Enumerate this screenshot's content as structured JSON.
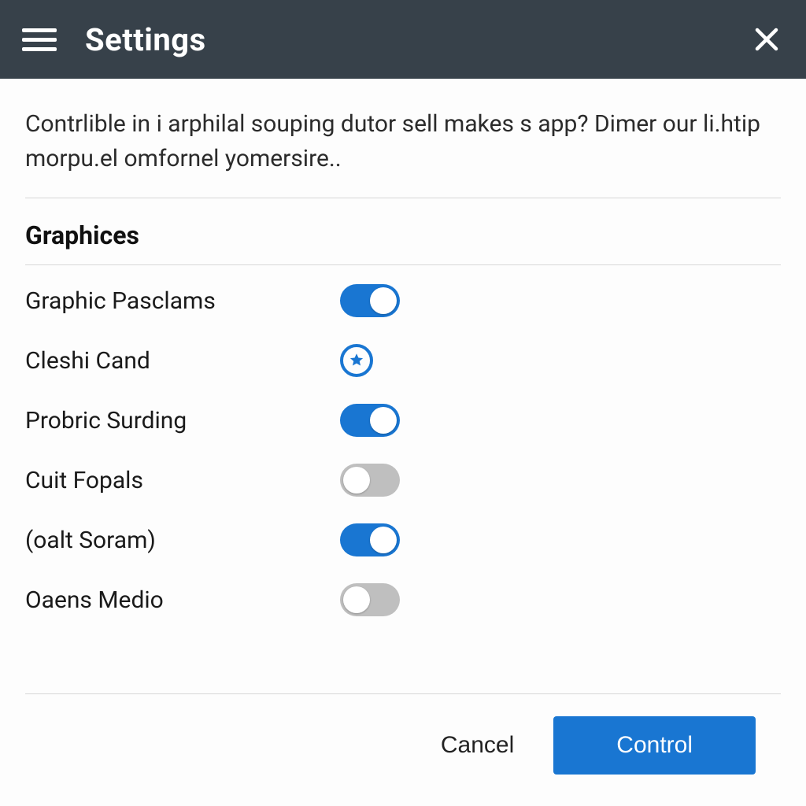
{
  "header": {
    "title": "Settings"
  },
  "description": "Contrlible in i arphilal souping dutor sell makes s app? Dimer our li.htip morpu.el omfornel yomersire..",
  "section": {
    "title": "Graphices",
    "options": [
      {
        "label": "Graphic Pasclams",
        "type": "toggle",
        "value": true
      },
      {
        "label": "Cleshi Cand",
        "type": "star",
        "value": true
      },
      {
        "label": "Probric Surding",
        "type": "toggle",
        "value": true
      },
      {
        "label": "Cuit Fopals",
        "type": "toggle",
        "value": false
      },
      {
        "label": "(oalt Soram)",
        "type": "toggle",
        "value": true
      },
      {
        "label": "Oaens Medio",
        "type": "toggle",
        "value": false
      }
    ]
  },
  "footer": {
    "cancel": "Cancel",
    "primary": "Control"
  },
  "colors": {
    "headerBg": "#37414a",
    "accent": "#1976d2",
    "toggleOff": "#bfbfbf"
  }
}
